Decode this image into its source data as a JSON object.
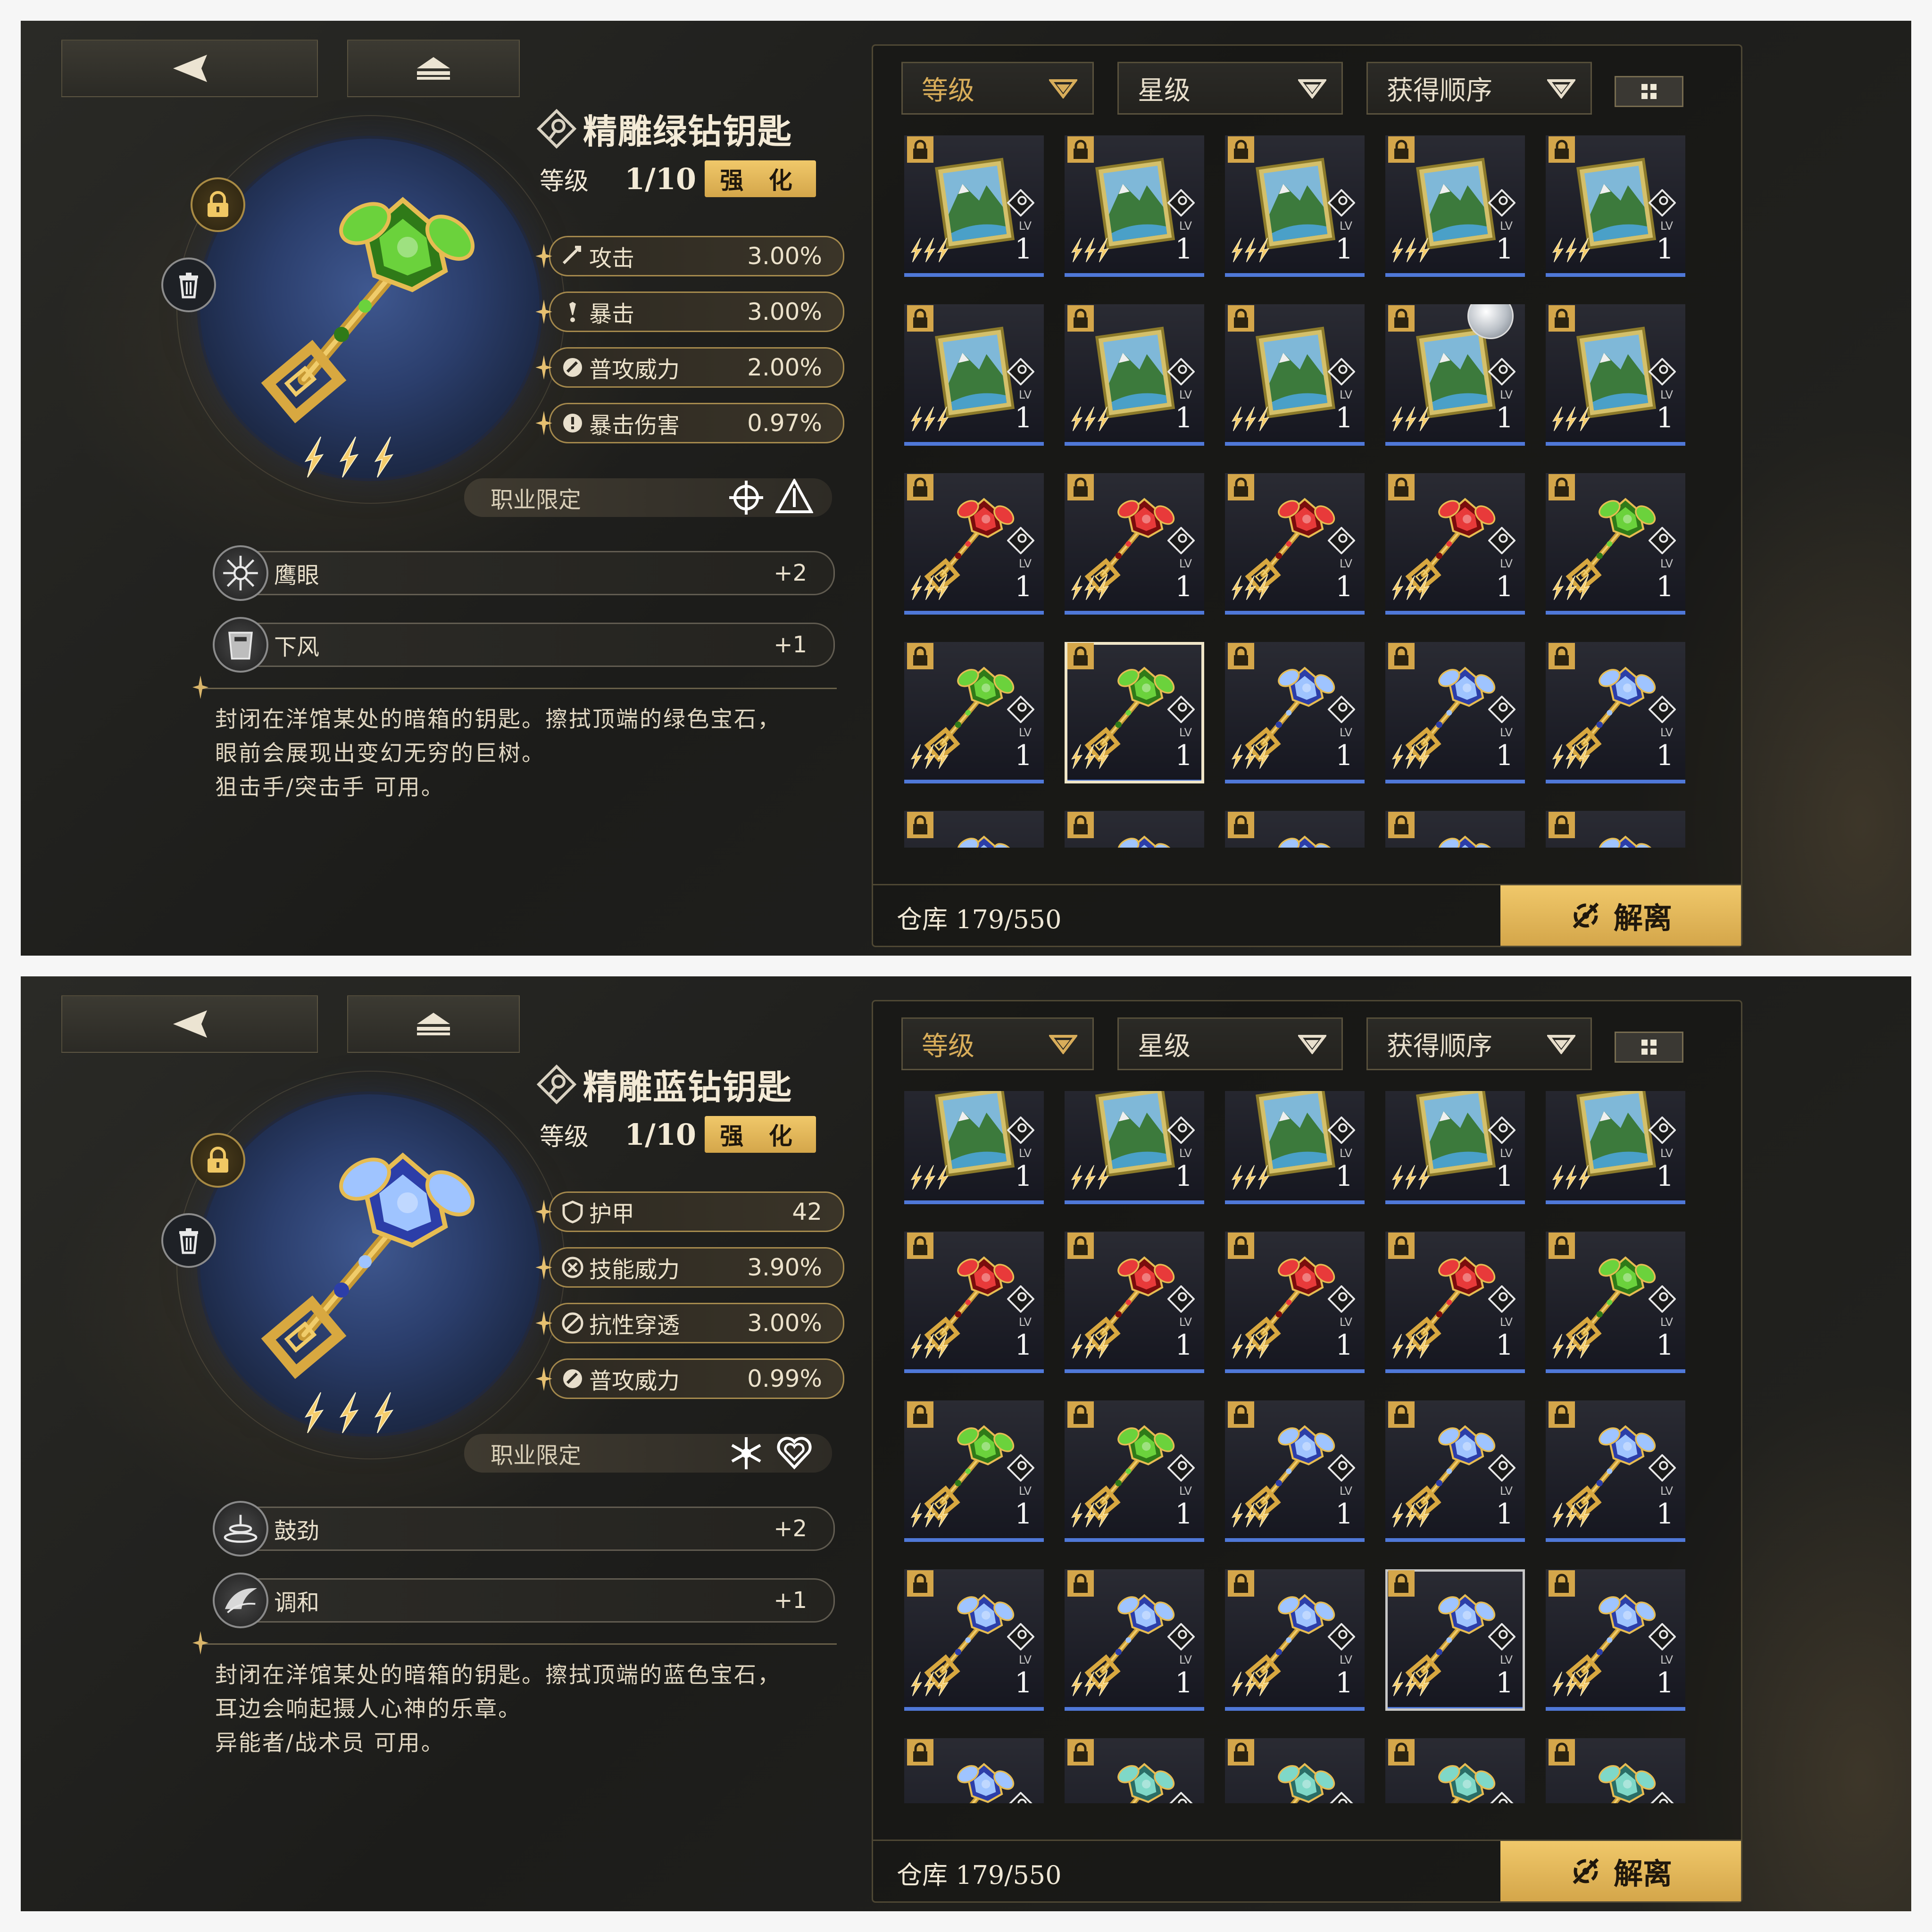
{
  "colors": {
    "gold": "#d8ad5a",
    "blue_bar": "#4f78d8",
    "panel": "#1c1c1a"
  },
  "panels": [
    {
      "item": {
        "name": "精雕绿钻钥匙",
        "gem": "green",
        "level_label": "等级",
        "level_value": "1/10",
        "enhance_label": "强 化",
        "stars": 3,
        "stats": [
          {
            "icon": "attack-icon",
            "name": "攻击",
            "value": "3.00%"
          },
          {
            "icon": "crit-icon",
            "name": "暴击",
            "value": "3.00%"
          },
          {
            "icon": "normal-attack-icon",
            "name": "普攻威力",
            "value": "2.00%"
          },
          {
            "icon": "crit-damage-icon",
            "name": "暴击伤害",
            "value": "0.97%"
          }
        ],
        "job_label": "职业限定",
        "job_icons": [
          "crosshair-icon",
          "pyramid-icon"
        ],
        "skills": [
          {
            "icon": "hawk-eye-icon",
            "name": "鹰眼",
            "value": "+2"
          },
          {
            "icon": "bucket-icon",
            "name": "下风",
            "value": "+1"
          }
        ],
        "description": [
          "封闭在洋馆某处的暗箱的钥匙。擦拭顶端的绿色宝石，",
          "眼前会展现出变幻无穷的巨树。",
          "狙击手/突击手 可用。"
        ]
      },
      "filters": [
        "等级",
        "星级",
        "获得顺序"
      ],
      "storage": "仓库 179/550",
      "release_label": "解离",
      "grid": [
        [
          "card",
          "card",
          "card",
          "card",
          "card"
        ],
        [
          "card",
          "card",
          "card",
          "card-pearl",
          "card"
        ],
        [
          "red",
          "red",
          "red",
          "red",
          "green"
        ],
        [
          "green",
          "green-sel",
          "blue",
          "blue",
          "blue"
        ],
        [
          "blue",
          "blue",
          "blue",
          "blue",
          "blue"
        ]
      ]
    },
    {
      "item": {
        "name": "精雕蓝钻钥匙",
        "gem": "blue",
        "level_label": "等级",
        "level_value": "1/10",
        "enhance_label": "强 化",
        "stars": 3,
        "stats": [
          {
            "icon": "armor-icon",
            "name": "护甲",
            "value": "42"
          },
          {
            "icon": "skill-power-icon",
            "name": "技能威力",
            "value": "3.90%"
          },
          {
            "icon": "resist-pierce-icon",
            "name": "抗性穿透",
            "value": "3.00%"
          },
          {
            "icon": "normal-attack-icon",
            "name": "普攻威力",
            "value": "0.99%"
          }
        ],
        "job_label": "职业限定",
        "job_icons": [
          "snowflake-icon",
          "heart-icon"
        ],
        "skills": [
          {
            "icon": "vortex-icon",
            "name": "鼓劲",
            "value": "+2"
          },
          {
            "icon": "wing-icon",
            "name": "调和",
            "value": "+1"
          }
        ],
        "description": [
          "封闭在洋馆某处的暗箱的钥匙。擦拭顶端的蓝色宝石，",
          "耳边会响起摄人心神的乐章。",
          "异能者/战术员 可用。"
        ]
      },
      "filters": [
        "等级",
        "星级",
        "获得顺序"
      ],
      "storage": "仓库 179/550",
      "release_label": "解离",
      "grid": [
        [
          "card-top",
          "card-top",
          "card-top",
          "card-top",
          "card-top"
        ],
        [
          "red",
          "red",
          "red",
          "red",
          "green"
        ],
        [
          "green",
          "green",
          "blue",
          "blue",
          "blue"
        ],
        [
          "blue",
          "blue",
          "blue",
          "blue-sel",
          "blue"
        ],
        [
          "blue",
          "teal",
          "teal",
          "teal",
          "teal"
        ]
      ]
    }
  ]
}
